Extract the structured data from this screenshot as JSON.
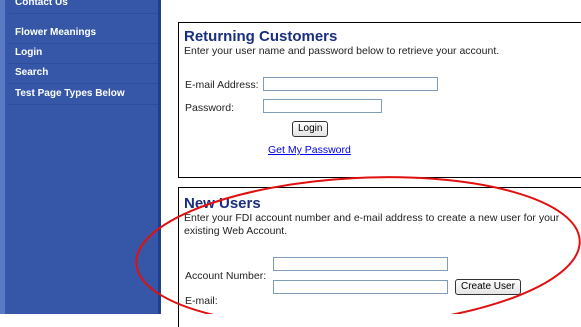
{
  "sidebar": {
    "items": [
      {
        "label": "Contact Us"
      },
      {
        "label": "Flower Meanings"
      },
      {
        "label": "Login"
      },
      {
        "label": "Search"
      },
      {
        "label": "Test Page Types Below"
      }
    ]
  },
  "returning": {
    "title": "Returning Customers",
    "description": "Enter your user name and password below to retrieve your account.",
    "email_label": "E-mail Address:",
    "email_value": "",
    "password_label": "Password:",
    "password_value": "",
    "login_button": "Login",
    "forgot_link": "Get My Password"
  },
  "new_users": {
    "title": "New Users",
    "description": "Enter your FDI account number and e-mail address to create a new user for your existing Web Account.",
    "account_label": "Account Number:",
    "account_value": "",
    "email_label": "E-mail:",
    "email_value": "",
    "create_button": "Create User"
  },
  "annotation": {
    "color": "#e01010"
  }
}
